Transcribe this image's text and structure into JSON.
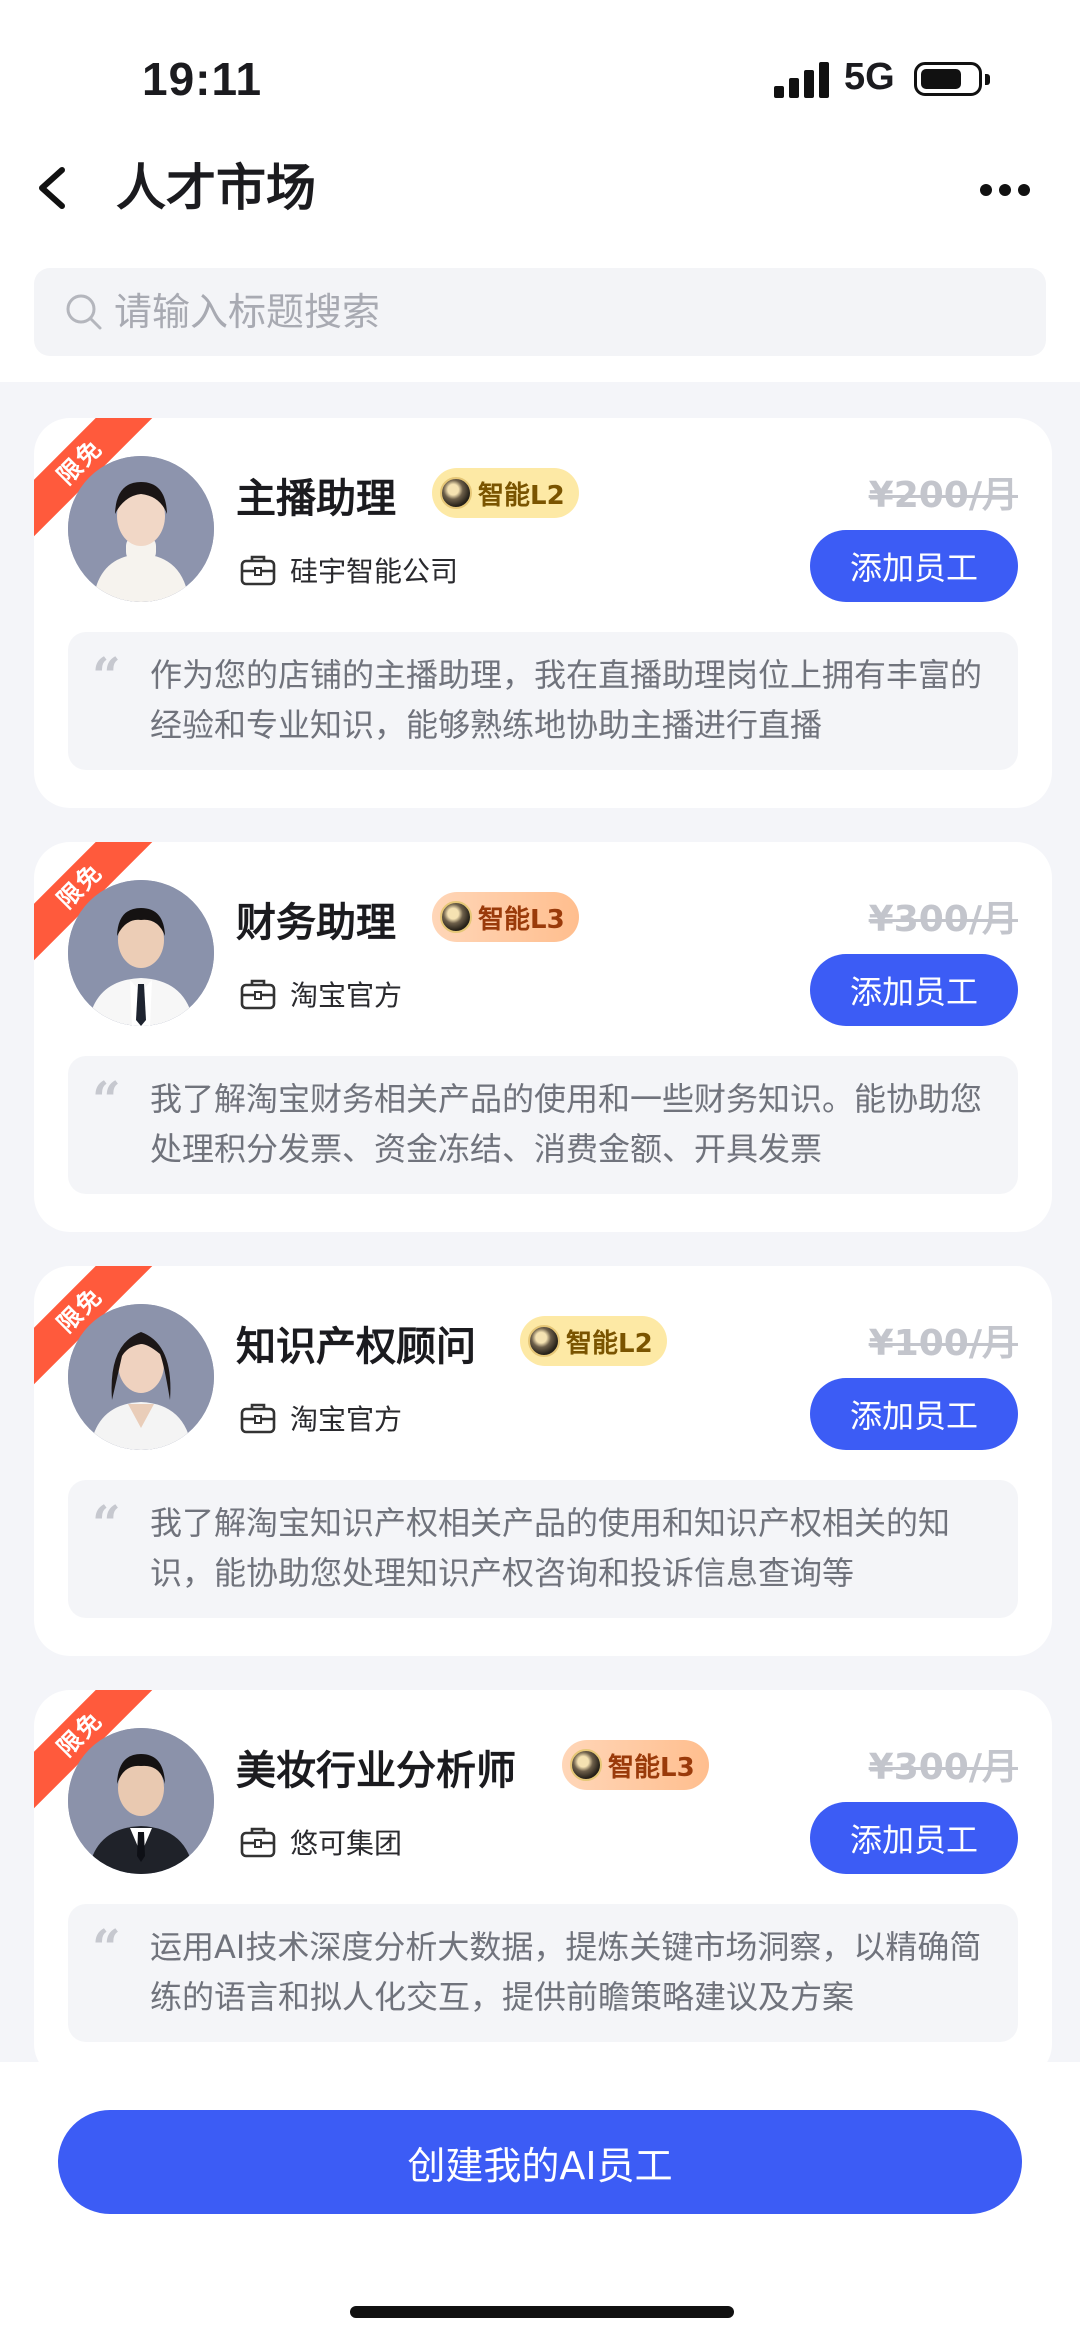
{
  "status": {
    "time": "19:11",
    "network": "5G"
  },
  "header": {
    "title": "人才市场"
  },
  "search": {
    "placeholder": "请输入标题搜索"
  },
  "cards": [
    {
      "ribbon": "限免",
      "name": "主播助理",
      "level": "智能L2",
      "price": "¥200/月",
      "company": "硅宇智能公司",
      "button": "添加员工",
      "desc": "作为您的店铺的主播助理，我在直播助理岗位上拥有丰富的经验和专业知识，能够熟练地协助主播进行直播"
    },
    {
      "ribbon": "限免",
      "name": "财务助理",
      "level": "智能L3",
      "price": "¥300/月",
      "company": "淘宝官方",
      "button": "添加员工",
      "desc": "我了解淘宝财务相关产品的使用和一些财务知识。能协助您处理积分发票、资金冻结、消费金额、开具发票"
    },
    {
      "ribbon": "限免",
      "name": "知识产权顾问",
      "level": "智能L2",
      "price": "¥100/月",
      "company": "淘宝官方",
      "button": "添加员工",
      "desc": "我了解淘宝知识产权相关产品的使用和知识产权相关的知识，能协助您处理知识产权咨询和投诉信息查询等"
    },
    {
      "ribbon": "限免",
      "name": "美妆行业分析师",
      "level": "智能L3",
      "price": "¥300/月",
      "company": "悠可集团",
      "button": "添加员工",
      "desc": "运用AI技术深度分析大数据，提炼关键市场洞察，以精确简练的语言和拟人化交互，提供前瞻策略建议及方案"
    }
  ],
  "footer": {
    "create_label": "创建我的AI员工"
  },
  "colors": {
    "accent": "#3c5cf5",
    "ribbon": "#ff5a3c"
  }
}
